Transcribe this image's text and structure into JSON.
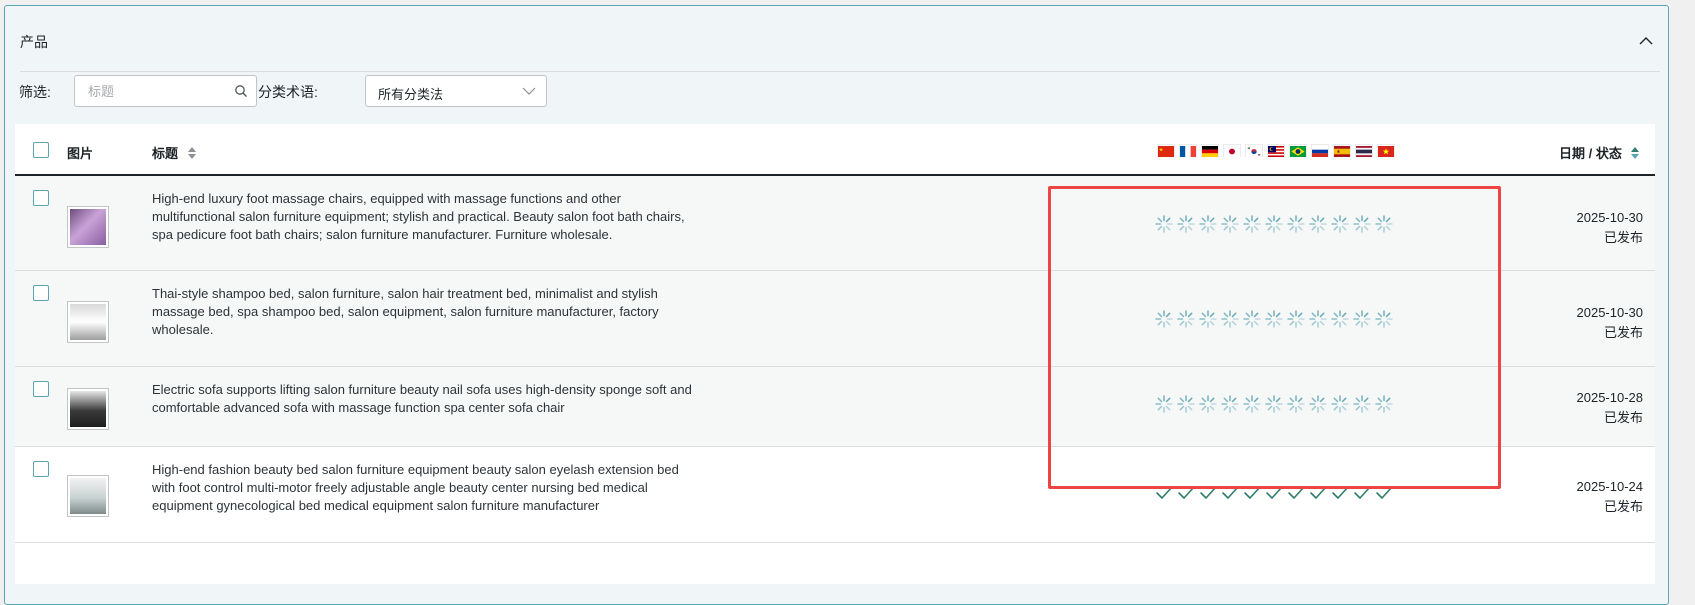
{
  "panel": {
    "title": "产品"
  },
  "filters": {
    "filter_label": "筛选:",
    "search_placeholder": "标题",
    "taxonomy_label": "分类术语:",
    "taxonomy_value": "所有分类法"
  },
  "table": {
    "headers": {
      "image": "图片",
      "title": "标题",
      "date_status": "日期 / 状态"
    },
    "languages": [
      {
        "code": "zh",
        "flag": "china-flag-icon"
      },
      {
        "code": "fr",
        "flag": "france-flag-icon"
      },
      {
        "code": "de",
        "flag": "germany-flag-icon"
      },
      {
        "code": "ja",
        "flag": "japan-flag-icon"
      },
      {
        "code": "ko",
        "flag": "korea-flag-icon"
      },
      {
        "code": "ms",
        "flag": "malaysia-flag-icon"
      },
      {
        "code": "pt-br",
        "flag": "brazil-flag-icon"
      },
      {
        "code": "ru",
        "flag": "russia-flag-icon"
      },
      {
        "code": "es",
        "flag": "spain-flag-icon"
      },
      {
        "code": "th",
        "flag": "thailand-flag-icon"
      },
      {
        "code": "vi",
        "flag": "vietnam-flag-icon"
      }
    ],
    "rows": [
      {
        "title": "High-end luxury foot massage chairs, equipped with massage functions and other multifunctional salon furniture equipment; stylish and practical. Beauty salon foot bath chairs, spa pedicure foot bath chairs; salon furniture manufacturer. Furniture wholesale.",
        "date": "2025-10-30",
        "status": "已发布",
        "translation_state": "loading"
      },
      {
        "title": "Thai-style shampoo bed, salon furniture, salon hair treatment bed, minimalist and stylish massage bed, spa shampoo bed, salon equipment, salon furniture manufacturer, factory wholesale.",
        "date": "2025-10-30",
        "status": "已发布",
        "translation_state": "loading"
      },
      {
        "title": "Electric sofa supports lifting salon furniture beauty nail sofa uses high-density sponge soft and comfortable advanced sofa with massage function spa center sofa chair",
        "date": "2025-10-28",
        "status": "已发布",
        "translation_state": "loading"
      },
      {
        "title": "High-end fashion beauty bed salon furniture equipment beauty salon eyelash extension bed with foot control multi-motor freely adjustable angle beauty center nursing bed medical equipment gynecological bed medical equipment salon furniture manufacturer",
        "date": "2025-10-24",
        "status": "已发布",
        "translation_state": "done"
      }
    ]
  },
  "colors": {
    "accent": "#5aa4b4",
    "highlight": "#ef4444",
    "check": "#2e7d6e"
  }
}
